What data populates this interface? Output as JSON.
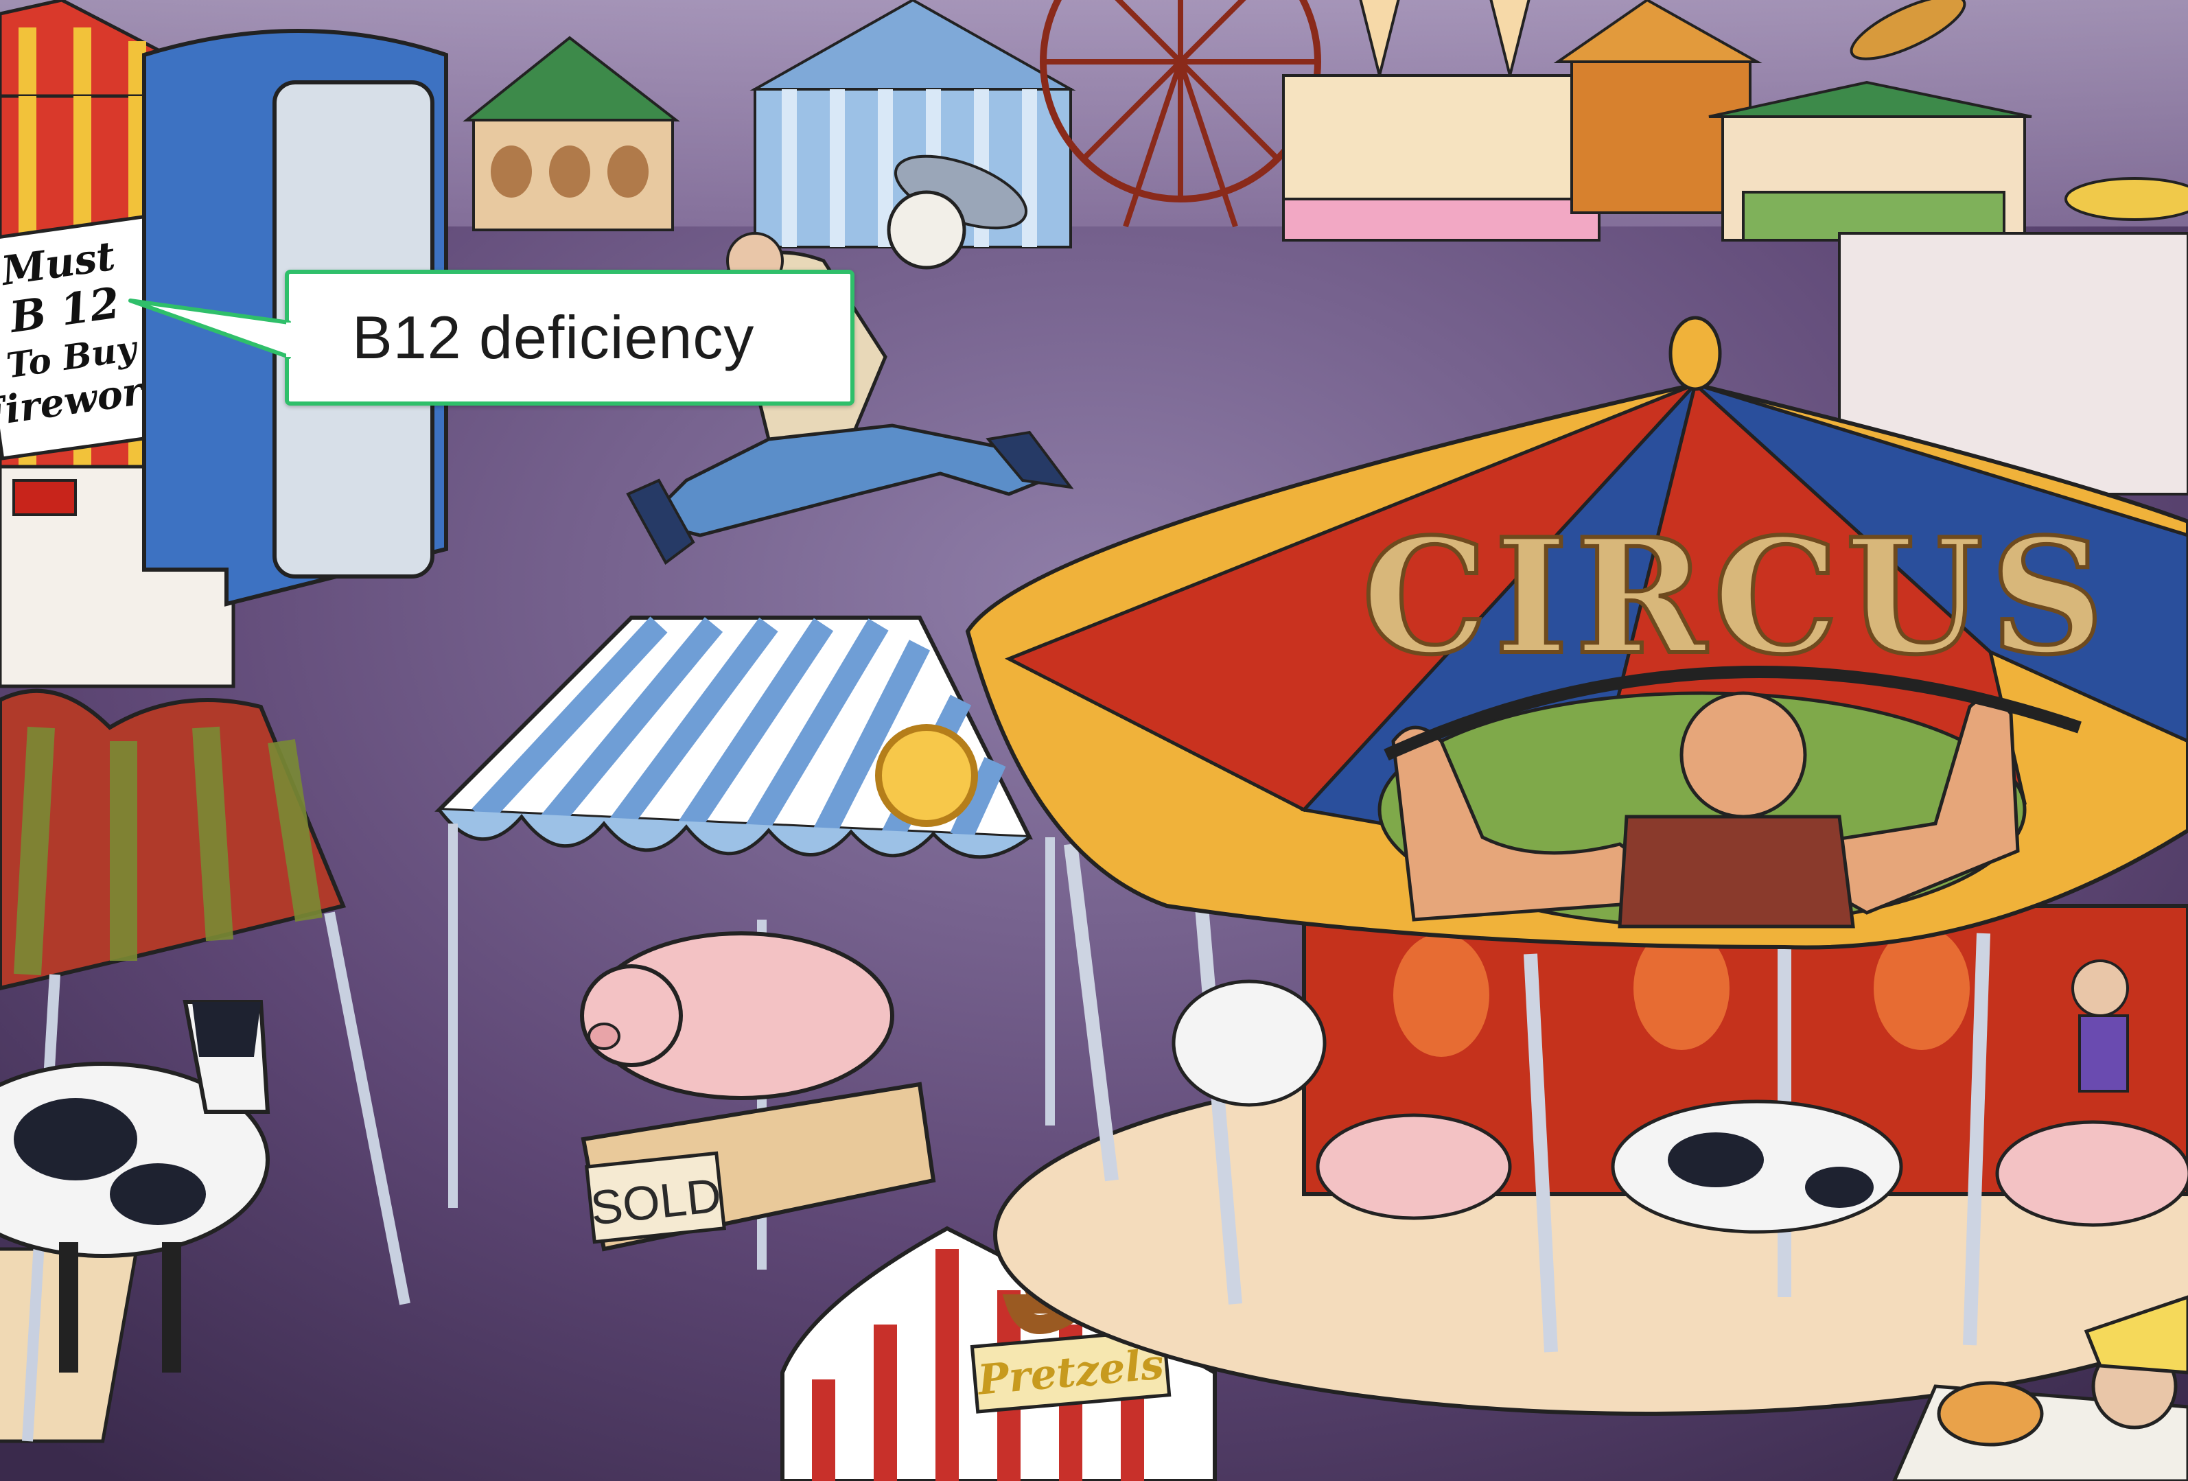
{
  "callout": {
    "text": "B12 deficiency"
  },
  "signs": {
    "fireworks": [
      "Must",
      "B 12",
      "To Buy",
      "Fireworks"
    ],
    "circus": "CIRCUS",
    "sold": "SOLD",
    "pretzels": "Pretzels"
  },
  "colors": {
    "ground": "#5a4470",
    "callout_border": "#2fbf6a",
    "circus_red": "#c9321f",
    "circus_blue": "#2a4f9c",
    "circus_gold": "#f0b23a"
  }
}
